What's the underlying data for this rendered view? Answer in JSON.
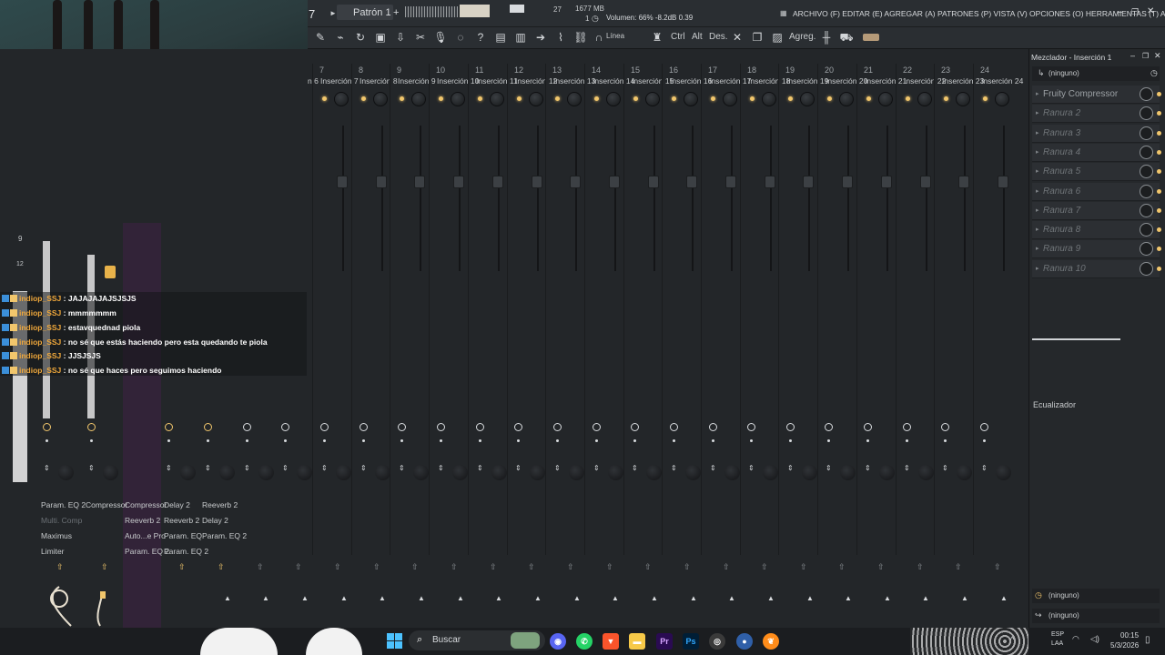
{
  "topbar": {
    "pattern_num": "7",
    "pattern_name": "Patrón 1",
    "cpu": "27",
    "memory": "1677 MB",
    "poly": "1",
    "hint": "Volumen: 66%  -8.2dB  0.39",
    "menu": "ARCHIVO (F) EDITAR (E) AGREGAR (A) PATRONES (P) VISTA (V) OPCIONES (O) HERRAMIENTAS (T) AYUDA"
  },
  "toolbar": {
    "line_label": "Línea",
    "ctrl_label": "Ctrl",
    "alt_label": "Alt",
    "des_label": "Des.",
    "agreg_label": "Agreg."
  },
  "mixer": {
    "partial_label": "n 6",
    "channels": [
      {
        "num": "7",
        "name": "Inserción 7"
      },
      {
        "num": "8",
        "name": "Inserción 8"
      },
      {
        "num": "9",
        "name": "Inserción 9"
      },
      {
        "num": "10",
        "name": "Inserción 10"
      },
      {
        "num": "11",
        "name": "Inserción 11"
      },
      {
        "num": "12",
        "name": "Inserción 12"
      },
      {
        "num": "13",
        "name": "Inserción 13"
      },
      {
        "num": "14",
        "name": "Inserción 14"
      },
      {
        "num": "15",
        "name": "Inserción 15"
      },
      {
        "num": "16",
        "name": "Inserción 16"
      },
      {
        "num": "17",
        "name": "Inserción 17"
      },
      {
        "num": "18",
        "name": "Inserción 18"
      },
      {
        "num": "19",
        "name": "Inserción 19"
      },
      {
        "num": "20",
        "name": "Inserción 20"
      },
      {
        "num": "21",
        "name": "Inserción 21"
      },
      {
        "num": "22",
        "name": "Inserción 22"
      },
      {
        "num": "23",
        "name": "Inserción 23"
      },
      {
        "num": "24",
        "name": "Inserción 24"
      }
    ],
    "meter_labels": [
      "9",
      "12"
    ],
    "fx_col1": [
      "Param. EQ 2",
      "Multi. Comp",
      "Maximus",
      "Limiter"
    ],
    "fx_col2": [
      "Compressor"
    ],
    "fx_col3": [
      "Compressor",
      "Reeverb 2",
      "Auto...e Pro",
      "Param. EQ 2"
    ],
    "fx_col4": [
      "Delay 2",
      "Reeverb 2",
      "Param. EQ",
      "Param. EQ 2"
    ],
    "fx_col5": [
      "Reeverb 2",
      "Delay 2",
      "Param. EQ 2"
    ]
  },
  "chat": [
    {
      "user": "indiop_SSJ",
      "msg": "JAJAJAJAJSJSJS"
    },
    {
      "user": "indiop_SSJ",
      "msg": "mmmmmmm"
    },
    {
      "user": "indiop_SSJ",
      "msg": "estavquednad piola"
    },
    {
      "user": "indiop_SSJ",
      "msg": "no sé que estás haciendo pero esta quedando te piola"
    },
    {
      "user": "indiop_SSJ",
      "msg": "JJSJSJS"
    },
    {
      "user": "indiop_SSJ",
      "msg": "no sé que haces pero seguimos haciendo"
    }
  ],
  "panel": {
    "title": "Mezclador - Inserción 1",
    "input": "(ninguno)",
    "slots": [
      "Fruity Compressor",
      "Ranura 2",
      "Ranura 3",
      "Ranura 4",
      "Ranura 5",
      "Ranura 6",
      "Ranura 7",
      "Ranura 8",
      "Ranura 9",
      "Ranura 10"
    ],
    "eq_label": "Ecualizador",
    "out1": "(ninguno)",
    "out2": "(ninguno)"
  },
  "taskbar": {
    "search": "Buscar",
    "lang1": "ESP",
    "lang2": "LAA",
    "time": "00:15",
    "date": "5/3/2026"
  },
  "colors": {
    "accent": "#f1c66c",
    "bg": "#232629"
  }
}
